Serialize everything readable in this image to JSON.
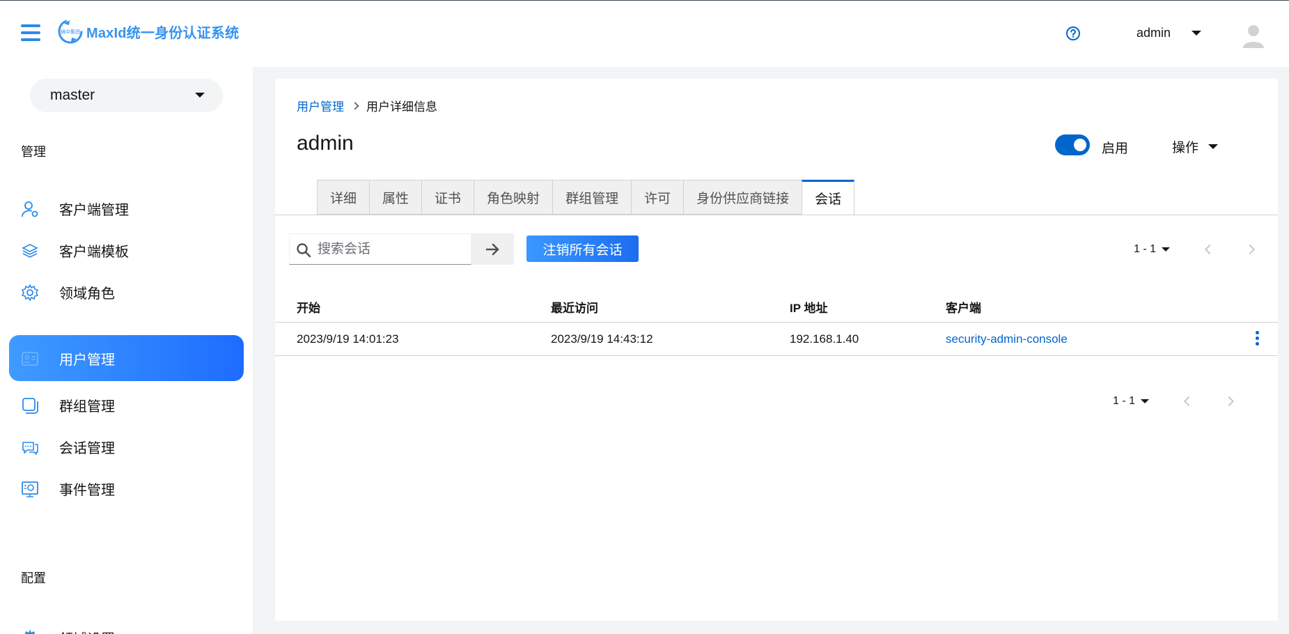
{
  "header": {
    "app_title": "MaxId统一身份认证系统",
    "logo_text": "镜中集团",
    "username": "admin"
  },
  "sidebar": {
    "realm": "master",
    "section_manage": "管理",
    "section_config": "配置",
    "items": [
      {
        "label": "客户端管理",
        "icon": "user-client-icon"
      },
      {
        "label": "客户端模板",
        "icon": "layers-icon"
      },
      {
        "label": "领域角色",
        "icon": "gear-icon"
      },
      {
        "label": "用户管理",
        "icon": "id-card-icon",
        "active": true
      },
      {
        "label": "群组管理",
        "icon": "group-icon"
      },
      {
        "label": "会话管理",
        "icon": "chat-icon"
      },
      {
        "label": "事件管理",
        "icon": "event-icon"
      }
    ],
    "config_items": [
      {
        "label": "领域设置",
        "icon": "cog-icon"
      }
    ]
  },
  "breadcrumb": {
    "parent": "用户管理",
    "current": "用户详细信息"
  },
  "page": {
    "title": "admin",
    "enabled_label": "启用",
    "enabled": true,
    "actions_label": "操作"
  },
  "tabs": [
    {
      "label": "详细"
    },
    {
      "label": "属性"
    },
    {
      "label": "证书"
    },
    {
      "label": "角色映射"
    },
    {
      "label": "群组管理"
    },
    {
      "label": "许可"
    },
    {
      "label": "身份供应商链接"
    },
    {
      "label": "会话",
      "active": true
    }
  ],
  "toolbar": {
    "search_placeholder": "搜索会话",
    "logout_all_label": "注销所有会话",
    "pagination": "1 - 1"
  },
  "table": {
    "columns": [
      "开始",
      "最近访问",
      "IP 地址",
      "客户端"
    ],
    "rows": [
      {
        "start": "2023/9/19 14:01:23",
        "last_access": "2023/9/19 14:43:12",
        "ip": "192.168.1.40",
        "client": "security-admin-console"
      }
    ]
  },
  "footer_pagination": "1 - 1",
  "colors": {
    "accent": "#0066cc",
    "brand": "#3593f0",
    "active_nav_start": "#3f9bff",
    "active_nav_end": "#1e6cff"
  }
}
